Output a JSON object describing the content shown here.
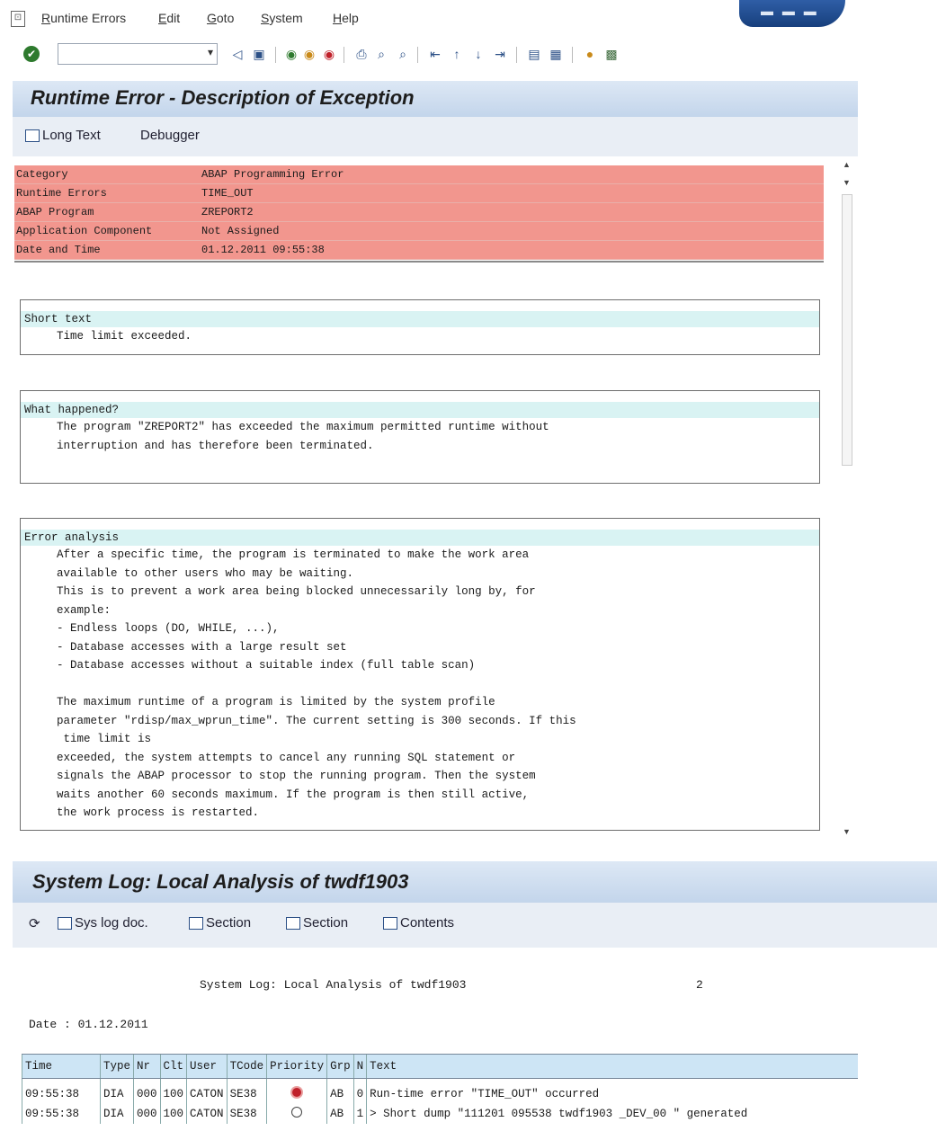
{
  "menu": {
    "items": [
      "Runtime Errors",
      "Edit",
      "Goto",
      "System",
      "Help"
    ]
  },
  "toolbar": {
    "command_value": ""
  },
  "runtime_error": {
    "title": "Runtime Error - Description of Exception",
    "buttons": {
      "long_text": "Long Text",
      "debugger": "Debugger"
    },
    "header": [
      {
        "key": "Category",
        "value": "ABAP Programming Error"
      },
      {
        "key": "Runtime Errors",
        "value": "TIME_OUT"
      },
      {
        "key": "ABAP Program",
        "value": "ZREPORT2"
      },
      {
        "key": "Application Component",
        "value": "Not Assigned"
      },
      {
        "key": "Date and Time",
        "value": "01.12.2011 09:55:38"
      }
    ],
    "short_text": {
      "heading": "Short text",
      "lines": [
        "Time limit exceeded."
      ]
    },
    "what_happened": {
      "heading": "What happened?",
      "lines": [
        "The program \"ZREPORT2\" has exceeded the maximum permitted runtime without",
        "interruption and has therefore been terminated."
      ]
    },
    "error_analysis": {
      "heading": "Error analysis",
      "lines": [
        "After a specific time, the program is terminated to make the work area",
        "available to other users who may be waiting.",
        "This is to prevent a work area being blocked unnecessarily long by, for",
        "example:",
        "- Endless loops (DO, WHILE, ...),",
        "- Database accesses with a large result set",
        "- Database accesses without a suitable index (full table scan)",
        "",
        "The maximum runtime of a program is limited by the system profile",
        "parameter \"rdisp/max_wprun_time\". The current setting is 300 seconds. If this",
        " time limit is",
        "exceeded, the system attempts to cancel any running SQL statement or",
        "signals the ABAP processor to stop the running program. Then the system",
        "waits another 60 seconds maximum. If the program is then still active,",
        "the work process is restarted."
      ]
    }
  },
  "system_log": {
    "title": "System Log: Local Analysis of twdf1903",
    "buttons": {
      "syslog_doc": "Sys log doc.",
      "section_prev": "Section",
      "section_next": "Section",
      "contents": "Contents"
    },
    "heading": "System Log: Local Analysis of twdf1903",
    "page": "2",
    "date": "Date : 01.12.2011",
    "columns": [
      "Time",
      "Type",
      "Nr",
      "Clt",
      "User",
      "TCode",
      "Priority",
      "Grp",
      "N",
      "Text"
    ],
    "rows": [
      {
        "time": "09:55:38",
        "type": "DIA",
        "nr": "000",
        "clt": "100",
        "user": "CATON",
        "tcode": "SE38",
        "priority": "red",
        "grp": "AB",
        "n": "0",
        "text": "Run-time error \"TIME_OUT\" occurred"
      },
      {
        "time": "09:55:38",
        "type": "DIA",
        "nr": "000",
        "clt": "100",
        "user": "CATON",
        "tcode": "SE38",
        "priority": "empty",
        "grp": "AB",
        "n": "1",
        "text": "> Short dump \"111201 095538 twdf1903 _DEV_00 \" generated"
      }
    ]
  },
  "colors": {
    "header_bg": "#f2968e",
    "section_head_bg": "#d9f3f3",
    "title_bar": "#c3d5eb",
    "priority_error": "#c0202a"
  }
}
